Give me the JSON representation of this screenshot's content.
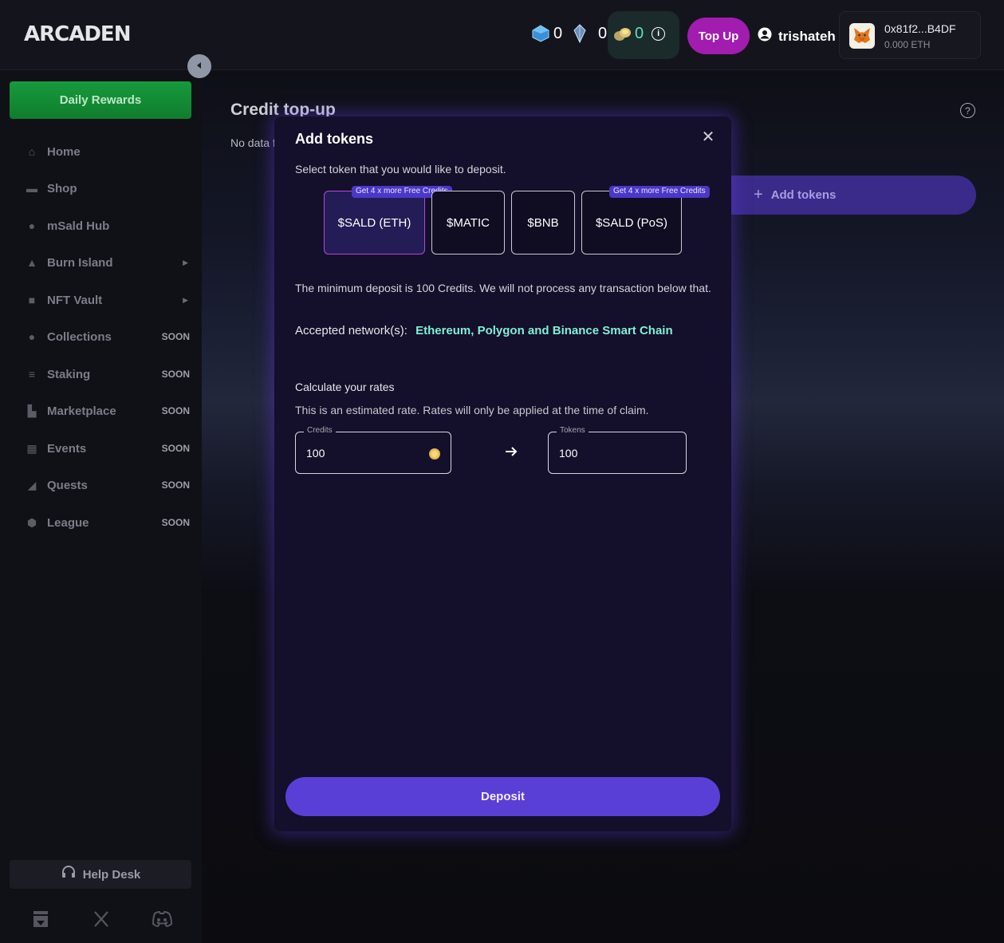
{
  "header": {
    "logo": "ARCADEN",
    "currencies": [
      {
        "icon": "blue-gem-icon",
        "value": "0"
      },
      {
        "icon": "crystal-icon",
        "value": "0"
      },
      {
        "icon": "coins-icon",
        "value": "0"
      }
    ],
    "topup_label": "Top Up",
    "username": "trishateh",
    "wallet_address": "0x81f2...B4DF",
    "wallet_balance": "0.000 ETH"
  },
  "sidebar": {
    "daily_rewards": "Daily Rewards",
    "items": [
      {
        "label": "Home",
        "icon": "home-icon",
        "badge": "",
        "arrow": false
      },
      {
        "label": "Shop",
        "icon": "shop-icon",
        "badge": "",
        "arrow": false
      },
      {
        "label": "mSald Hub",
        "icon": "hub-icon",
        "badge": "",
        "arrow": false
      },
      {
        "label": "Burn Island",
        "icon": "burn-icon",
        "badge": "",
        "arrow": true
      },
      {
        "label": "NFT Vault",
        "icon": "vault-icon",
        "badge": "",
        "arrow": true
      },
      {
        "label": "Collections",
        "icon": "collections-icon",
        "badge": "SOON",
        "arrow": false
      },
      {
        "label": "Staking",
        "icon": "staking-icon",
        "badge": "SOON",
        "arrow": false
      },
      {
        "label": "Marketplace",
        "icon": "marketplace-icon",
        "badge": "SOON",
        "arrow": false
      },
      {
        "label": "Events",
        "icon": "events-icon",
        "badge": "SOON",
        "arrow": false
      },
      {
        "label": "Quests",
        "icon": "quests-icon",
        "badge": "SOON",
        "arrow": false
      },
      {
        "label": "League",
        "icon": "league-icon",
        "badge": "SOON",
        "arrow": false
      }
    ],
    "help_desk": "Help Desk"
  },
  "main": {
    "title": "Credit top-up",
    "no_data": "No data f",
    "add_tokens_label": "Add tokens"
  },
  "modal": {
    "title": "Add tokens",
    "subtitle": "Select token that you would like to deposit.",
    "tokens": [
      {
        "label": "$SALD (ETH)",
        "badge": "Get 4 x more Free Credits"
      },
      {
        "label": "$MATIC",
        "badge": ""
      },
      {
        "label": "$BNB",
        "badge": ""
      },
      {
        "label": "$SALD (PoS)",
        "badge": "Get 4 x more Free Credits"
      }
    ],
    "min_note": "The minimum deposit is 100 Credits. We will not process any transaction below that.",
    "networks_label": "Accepted network(s):",
    "networks_value": "Ethereum, Polygon and Binance Smart Chain",
    "calc_title": "Calculate your rates",
    "calc_note": "This is an estimated rate. Rates will only be applied at the time of claim.",
    "credits_label": "Credits",
    "credits_value": "100",
    "tokens_label": "Tokens",
    "tokens_value": "100",
    "deposit_label": "Deposit"
  }
}
